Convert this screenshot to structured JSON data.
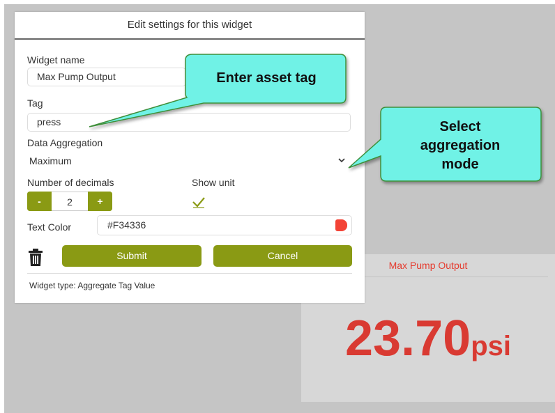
{
  "dialog": {
    "title": "Edit settings for this widget",
    "widget_name_label": "Widget name",
    "widget_name_value": "Max Pump Output",
    "tag_label": "Tag",
    "tag_value": "press",
    "aggregation_label": "Data Aggregation",
    "aggregation_value": "Maximum",
    "decimals_label": "Number of decimals",
    "decimals_minus": "-",
    "decimals_value": "2",
    "decimals_plus": "+",
    "show_unit_label": "Show unit",
    "show_unit_checked": true,
    "text_color_label": "Text Color",
    "text_color_value": "#F34336",
    "submit_label": "Submit",
    "cancel_label": "Cancel",
    "widget_type_text": "Widget type: Aggregate Tag Value"
  },
  "callouts": {
    "asset_tag": "Enter asset tag",
    "aggregation_line1": "Select",
    "aggregation_line2": "aggregation",
    "aggregation_line3": "mode"
  },
  "widget_preview": {
    "title": "Max Pump Output",
    "value": "23.70",
    "unit": "psi"
  },
  "colors": {
    "accent_olive": "#8a9a14",
    "callout_fill": "#6ff2e6",
    "text_color_swatch": "#F34336",
    "backdrop": "#c5c5c5"
  },
  "icons": {
    "trash": "trash-icon",
    "checkmark": "checkmark-icon",
    "chevron": "chevron-down-icon"
  }
}
